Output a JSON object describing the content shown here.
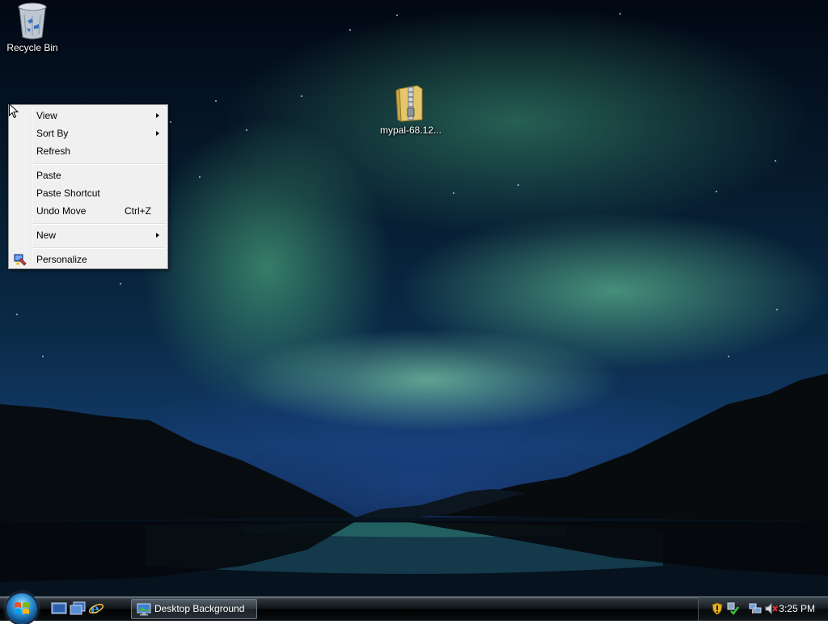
{
  "desktop": {
    "icons": [
      {
        "label": "Recycle Bin",
        "icon": "recycle-bin-icon"
      },
      {
        "label": "mypal-68.12...",
        "icon": "zip-folder-icon"
      }
    ]
  },
  "context_menu": {
    "items": [
      {
        "label": "View",
        "submenu": true
      },
      {
        "label": "Sort By",
        "submenu": true
      },
      {
        "label": "Refresh"
      },
      {
        "label": "Paste"
      },
      {
        "label": "Paste Shortcut"
      },
      {
        "label": "Undo Move",
        "shortcut": "Ctrl+Z"
      },
      {
        "label": "New",
        "submenu": true
      },
      {
        "label": "Personalize",
        "icon": "personalize-icon"
      }
    ]
  },
  "taskbar": {
    "start_icon": "windows-logo-icon",
    "quick_launch": [
      "show-desktop-icon",
      "switch-windows-icon",
      "internet-explorer-icon"
    ],
    "task_button": {
      "label": "Desktop Background",
      "icon": "desktop-background-icon"
    },
    "tray_icons": [
      "security-shield-icon",
      "network-check-icon",
      "network-icon",
      "volume-muted-icon"
    ],
    "clock": "3:25 PM"
  },
  "colors": {
    "menu_bg": "#f0f0f0",
    "menu_border": "#979797",
    "taskbar_bg": "#0e1216"
  }
}
